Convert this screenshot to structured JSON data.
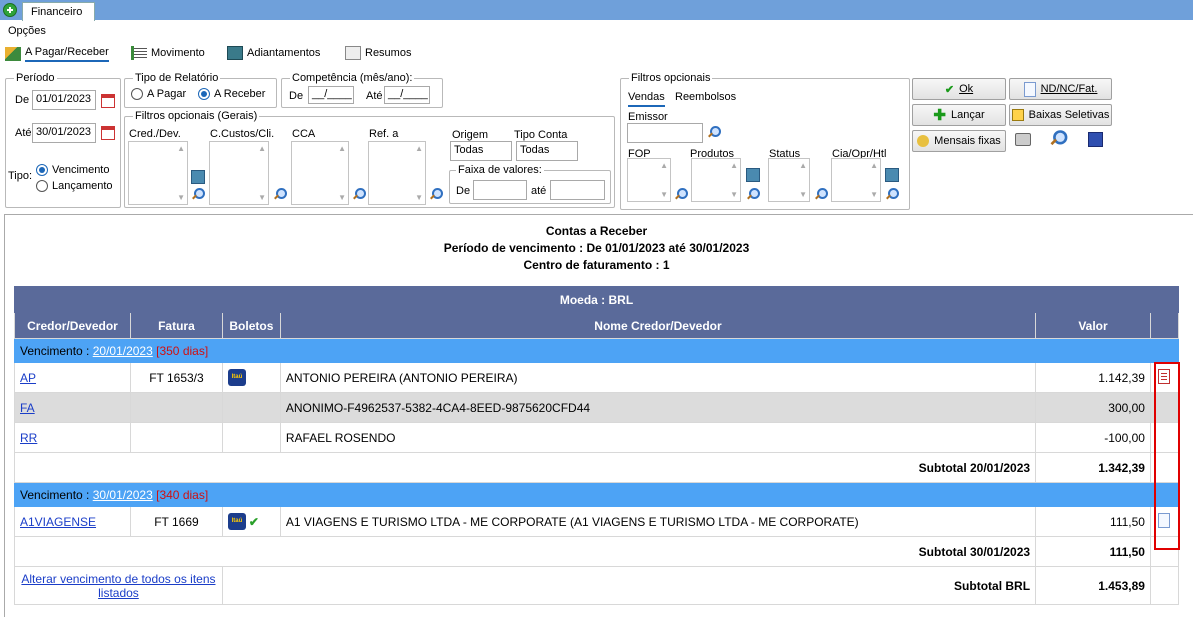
{
  "tabs": {
    "active": "Financeiro"
  },
  "menu": {
    "opcoes": "Opções"
  },
  "nav": [
    {
      "label": "A Pagar/Receber",
      "selected": true
    },
    {
      "label": "Movimento"
    },
    {
      "label": "Adiantamentos"
    },
    {
      "label": "Resumos"
    }
  ],
  "periodo": {
    "title": "Período",
    "de_label": "De",
    "de_value": "01/01/2023",
    "ate_label": "Até",
    "ate_value": "30/01/2023",
    "tipo_label": "Tipo:",
    "opt1": "Vencimento",
    "opt2": "Lançamento"
  },
  "tipo_relatorio": {
    "title": "Tipo de Relatório",
    "opt1": "A Pagar",
    "opt2": "A Receber"
  },
  "competencia": {
    "title": "Competência (mês/ano):",
    "de_label": "De",
    "de_value": "__/____",
    "ate_label": "Até",
    "ate_value": "__/____"
  },
  "filtros_gerais": {
    "title": "Filtros opcionais (Gerais)",
    "cred": "Cred./Dev.",
    "ccustos": "C.Custos/Cli.",
    "cca": "CCA",
    "ref": "Ref. a",
    "origem_label": "Origem",
    "origem_value": "Todas",
    "tipoconta_label": "Tipo Conta",
    "tipoconta_value": "Todas",
    "faixa_title": "Faixa de valores:",
    "faixa_de": "De",
    "faixa_ate": "até"
  },
  "filtros_opcionais": {
    "title": "Filtros opcionais",
    "tab_vendas": "Vendas",
    "tab_reembolsos": "Reembolsos",
    "emissor": "Emissor",
    "fop": "FOP",
    "produtos": "Produtos",
    "status": "Status",
    "cia": "Cia/Opr/Htl"
  },
  "buttons": {
    "ok": "Ok",
    "nd": "ND/NC/Fat.",
    "lancar": "Lançar",
    "baixas": "Baixas Seletivas",
    "mensais": "Mensais fixas"
  },
  "report": {
    "title": "Contas a Receber",
    "subtitle": "Período de vencimento : De 01/01/2023 até 30/01/2023",
    "centro": "Centro de faturamento : 1",
    "moeda": "Moeda : BRL",
    "columns": [
      "Credor/Devedor",
      "Fatura",
      "Boletos",
      "Nome Credor/Devedor",
      "Valor"
    ],
    "groups": [
      {
        "prefix": "Vencimento : ",
        "date": "20/01/2023",
        "days": "[350 dias]",
        "rows": [
          {
            "code": "AP",
            "fatura": "FT 1653/3",
            "bank": "Itaú",
            "name": "ANTONIO PEREIRA (ANTONIO PEREIRA)",
            "valor": "1.142,39"
          },
          {
            "code": "FA",
            "fatura": "",
            "bank": "",
            "name": "ANONIMO-F4962537-5382-4CA4-8EED-9875620CFD44",
            "valor": "300,00"
          },
          {
            "code": "RR",
            "fatura": "",
            "bank": "",
            "name": "RAFAEL ROSENDO",
            "valor": "-100,00"
          }
        ],
        "subtotal_label": "Subtotal 20/01/2023",
        "subtotal": "1.342,39"
      },
      {
        "prefix": "Vencimento : ",
        "date": "30/01/2023",
        "days": "[340 dias]",
        "rows": [
          {
            "code": "A1VIAGENSE",
            "fatura": "FT 1669",
            "bank": "Itaú",
            "name": "A1 VIAGENS E TURISMO LTDA - ME CORPORATE (A1 VIAGENS E TURISMO LTDA - ME CORPORATE)",
            "valor": "111,50"
          }
        ],
        "subtotal_label": "Subtotal 30/01/2023",
        "subtotal": "111,50"
      }
    ],
    "alterar_link": "Alterar vencimento de todos os itens listados",
    "total_label": "Subtotal BRL",
    "total": "1.453,89"
  }
}
